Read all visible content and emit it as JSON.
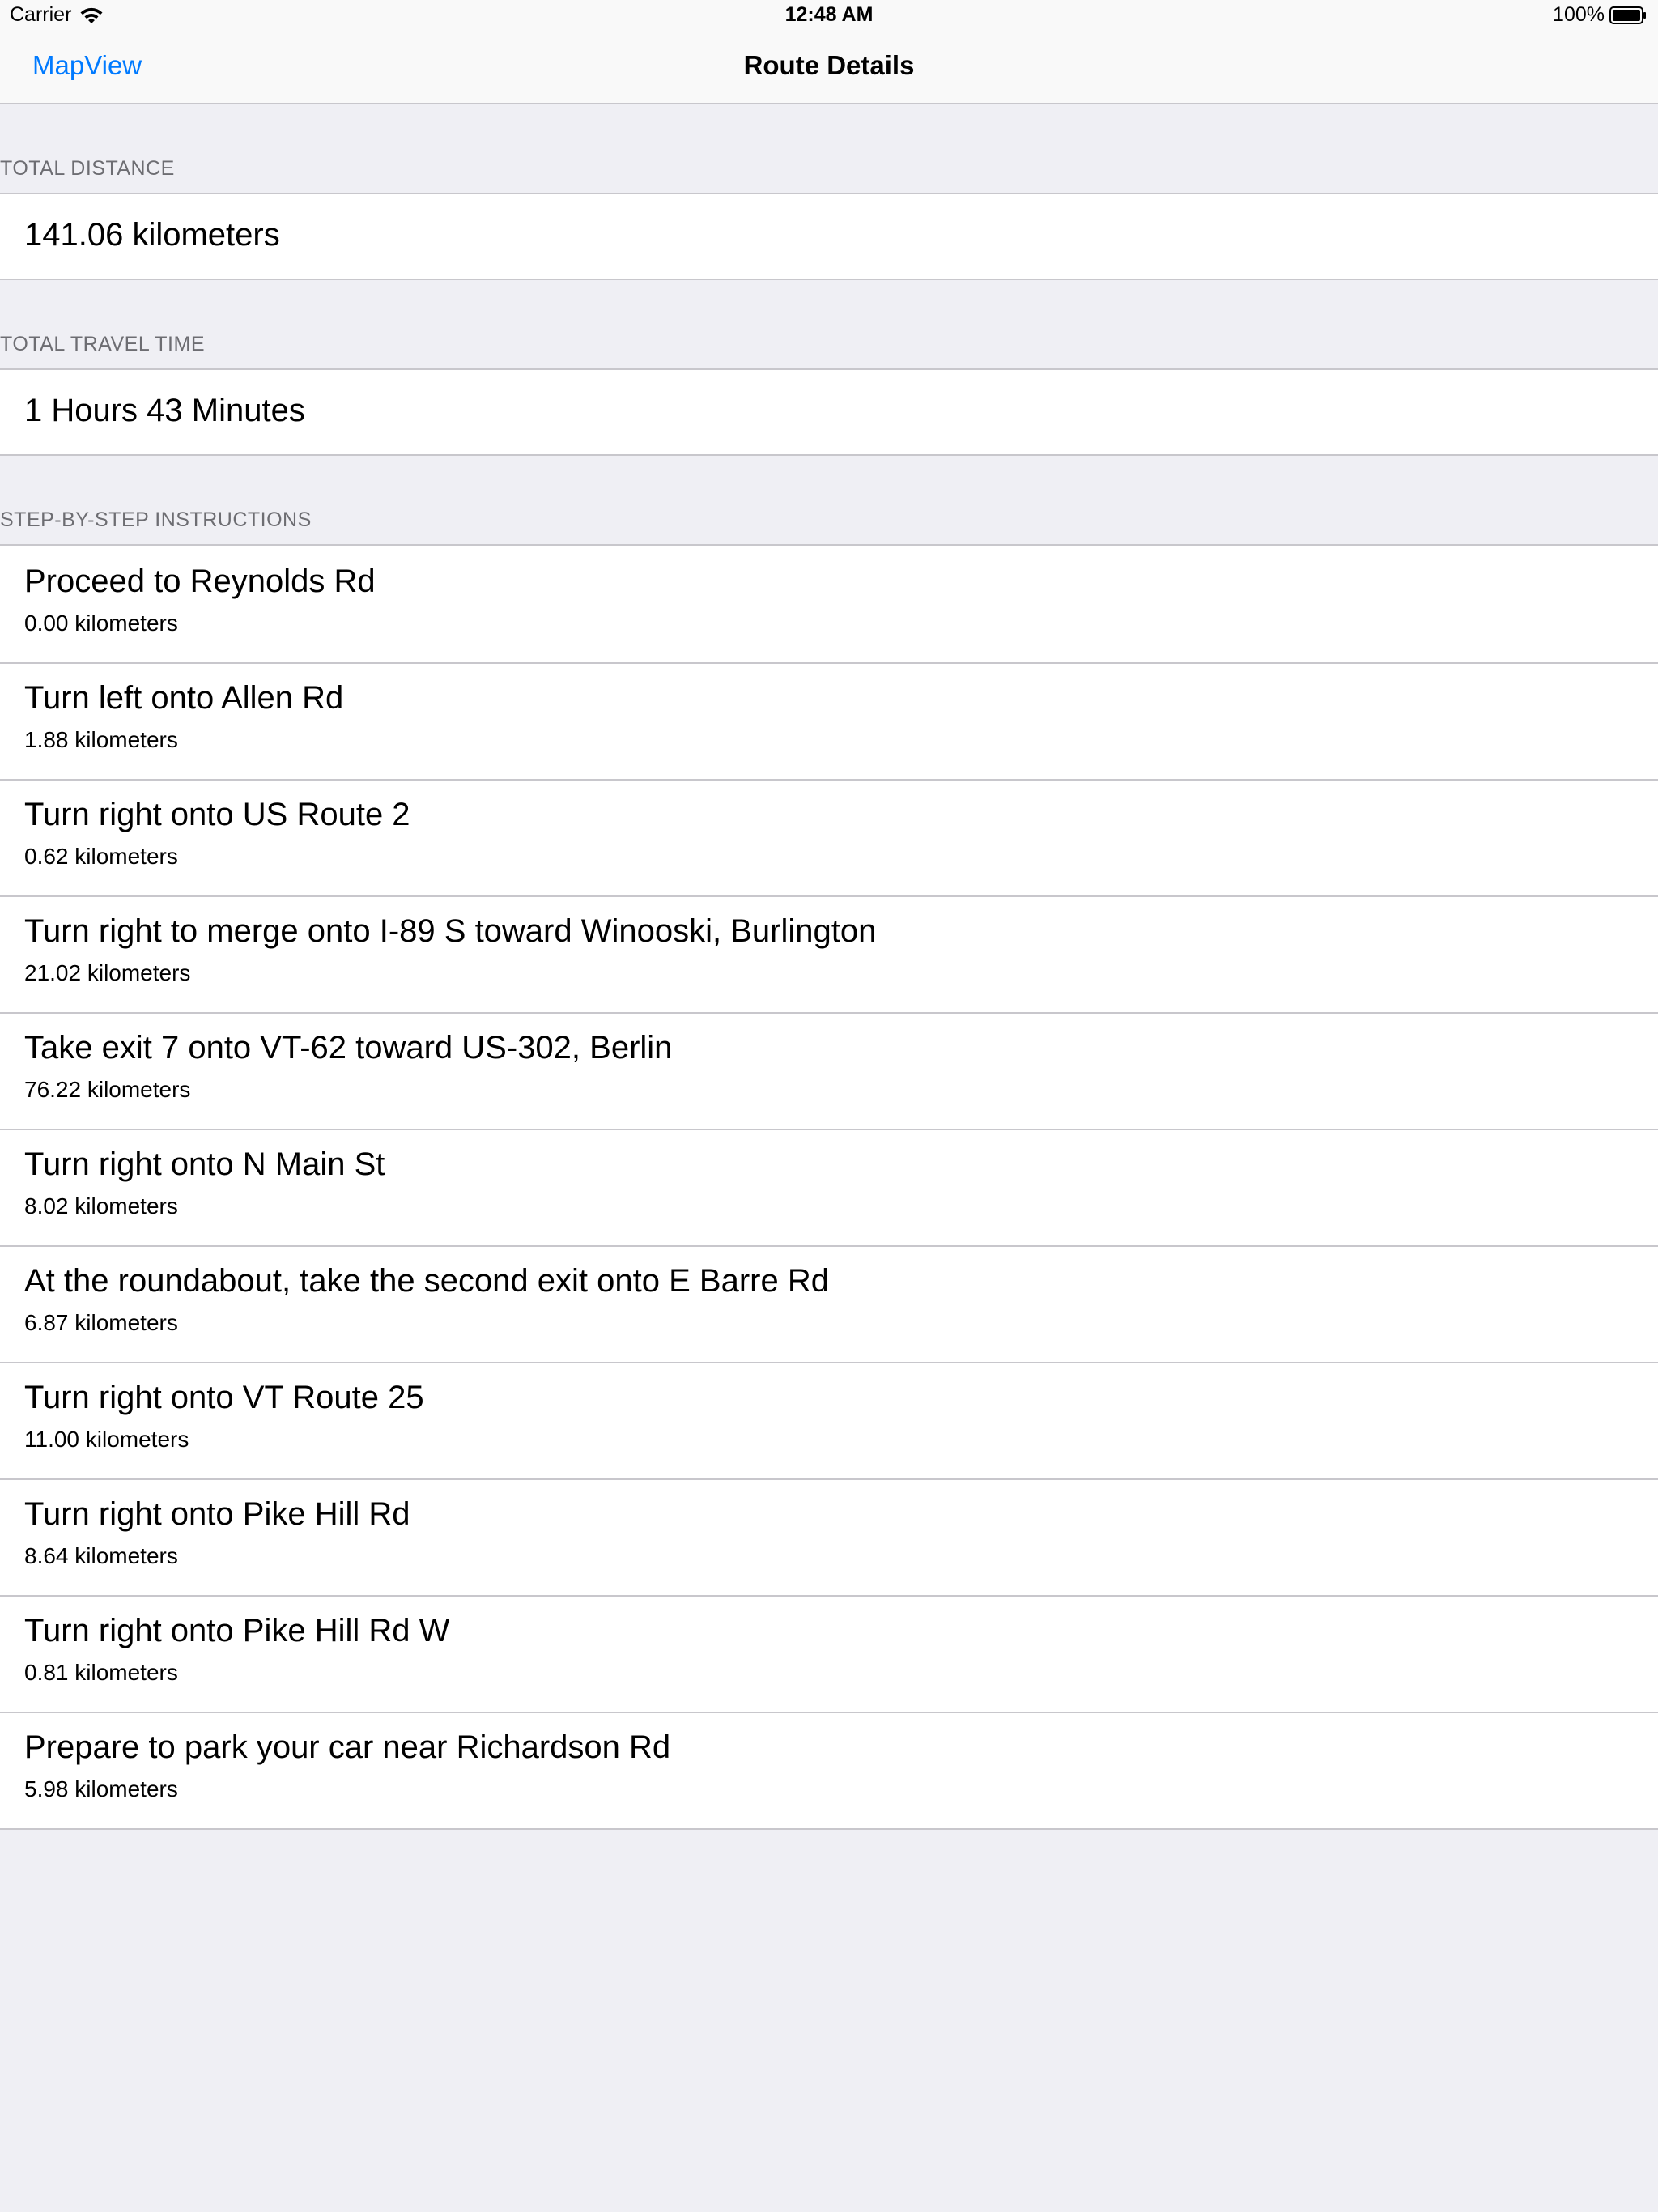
{
  "status_bar": {
    "carrier": "Carrier",
    "time": "12:48 AM",
    "battery": "100%"
  },
  "nav": {
    "back_label": "MapView",
    "title": "Route Details"
  },
  "sections": {
    "total_distance": {
      "header": "TOTAL DISTANCE",
      "value": "141.06 kilometers"
    },
    "total_travel_time": {
      "header": "TOTAL TRAVEL TIME",
      "value": "1 Hours 43 Minutes"
    },
    "steps": {
      "header": "STEP-BY-STEP INSTRUCTIONS",
      "items": [
        {
          "instruction": "Proceed to Reynolds Rd",
          "distance": "0.00 kilometers"
        },
        {
          "instruction": "Turn left onto Allen Rd",
          "distance": "1.88 kilometers"
        },
        {
          "instruction": "Turn right onto US Route 2",
          "distance": "0.62 kilometers"
        },
        {
          "instruction": "Turn right to merge onto I-89 S toward Winooski, Burlington",
          "distance": "21.02 kilometers"
        },
        {
          "instruction": "Take exit 7 onto VT-62 toward US-302, Berlin",
          "distance": "76.22 kilometers"
        },
        {
          "instruction": "Turn right onto N Main St",
          "distance": "8.02 kilometers"
        },
        {
          "instruction": "At the roundabout, take the second exit onto E Barre Rd",
          "distance": "6.87 kilometers"
        },
        {
          "instruction": "Turn right onto VT Route 25",
          "distance": "11.00 kilometers"
        },
        {
          "instruction": "Turn right onto Pike Hill Rd",
          "distance": "8.64 kilometers"
        },
        {
          "instruction": "Turn right onto Pike Hill Rd W",
          "distance": "0.81 kilometers"
        },
        {
          "instruction": "Prepare to park your car near Richardson Rd",
          "distance": "5.98 kilometers"
        }
      ]
    }
  },
  "colors": {
    "accent": "#007aff",
    "background": "#efeff4",
    "separator": "#c8c7cc",
    "header_text": "#6d6d72"
  }
}
